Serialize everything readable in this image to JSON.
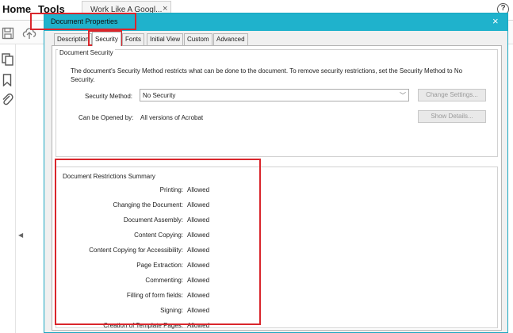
{
  "app": {
    "menu": {
      "home": "Home",
      "tools": "Tools"
    },
    "doc_tab": {
      "label": "Work Like A Googl...",
      "close": "×"
    },
    "help": "?"
  },
  "dialog": {
    "title": "Document Properties",
    "close": "×",
    "tabs": [
      {
        "label": "Description"
      },
      {
        "label": "Security"
      },
      {
        "label": "Fonts"
      },
      {
        "label": "Initial View"
      },
      {
        "label": "Custom"
      },
      {
        "label": "Advanced"
      }
    ],
    "active_tab": "Security",
    "security": {
      "legend": "Document Security",
      "description": "The document's Security Method restricts what can be done to the document. To remove security restrictions, set the Security Method to No Security.",
      "method_label": "Security Method:",
      "method_value": "No Security",
      "change_settings": "Change Settings...",
      "opened_label": "Can be Opened by:",
      "opened_value": "All versions of Acrobat",
      "show_details": "Show Details..."
    },
    "restrictions": {
      "legend": "Document Restrictions Summary",
      "items": [
        {
          "label": "Printing:",
          "value": "Allowed"
        },
        {
          "label": "Changing the Document:",
          "value": "Allowed"
        },
        {
          "label": "Document Assembly:",
          "value": "Allowed"
        },
        {
          "label": "Content Copying:",
          "value": "Allowed"
        },
        {
          "label": "Content Copying for Accessibility:",
          "value": "Allowed"
        },
        {
          "label": "Page Extraction:",
          "value": "Allowed"
        },
        {
          "label": "Commenting:",
          "value": "Allowed"
        },
        {
          "label": "Filling of form fields:",
          "value": "Allowed"
        },
        {
          "label": "Signing:",
          "value": "Allowed"
        },
        {
          "label": "Creation of Template Pages:",
          "value": "Allowed"
        }
      ]
    }
  },
  "colors": {
    "titlebar": "#1fb2cc",
    "highlight": "#d9262c"
  },
  "icons": {
    "save": "save-icon",
    "upload": "upload-icon",
    "pages": "pages-icon",
    "bookmark": "bookmark-icon",
    "attachment": "paperclip-icon",
    "collapse": "chevron-left-icon"
  }
}
